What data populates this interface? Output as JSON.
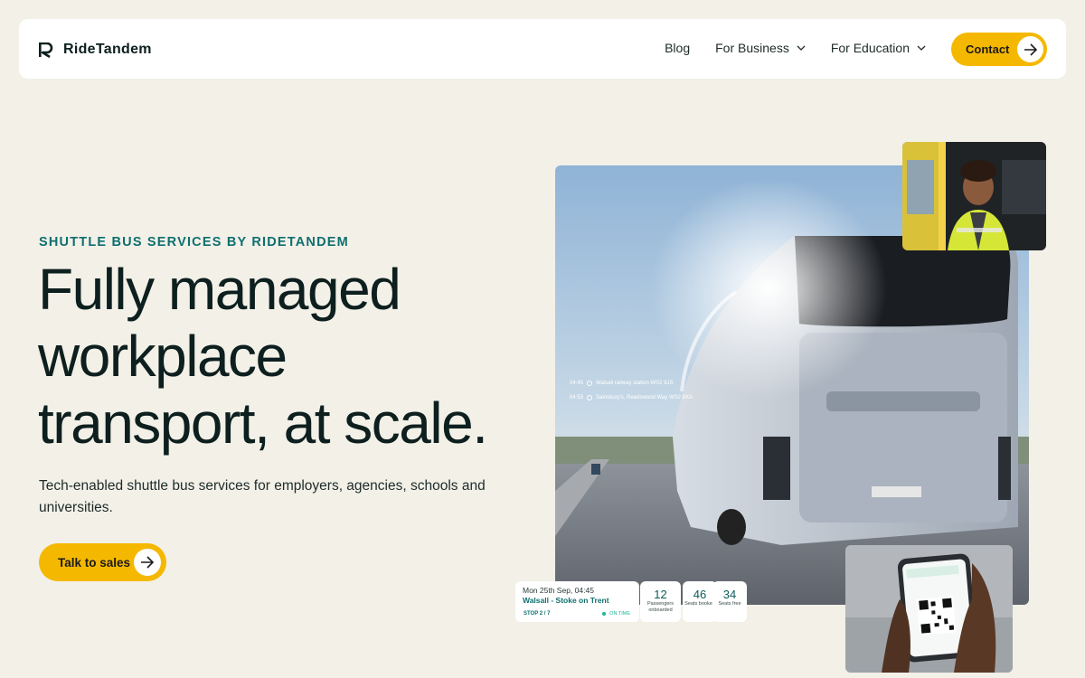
{
  "nav": {
    "brand": "RideTandem",
    "links": [
      {
        "label": "Blog",
        "has_dropdown": false
      },
      {
        "label": "For Business",
        "has_dropdown": true
      },
      {
        "label": "For Education",
        "has_dropdown": true
      }
    ],
    "contact_label": "Contact"
  },
  "hero": {
    "eyebrow": "SHUTTLE BUS SERVICES BY RIDETANDEM",
    "headline_lines": [
      "Fully managed",
      "workplace",
      "transport, at scale."
    ],
    "subhead": "Tech-enabled shuttle bus services for employers, agencies, schools and universities.",
    "cta_label": "Talk to sales"
  },
  "route_overlay": [
    {
      "time": "04:45",
      "stop": "Walsall railway station WS2 9JS"
    },
    {
      "time": "04:53",
      "stop": "Sainsbury's, Reedswood Way WS2 8XA"
    }
  ],
  "trip_card": {
    "date": "Mon 25th Sep, 04:45",
    "route": "Walsall - Stoke on Trent",
    "stop": "STOP 2 / 7",
    "status": "ON TIME"
  },
  "stats": [
    {
      "value": "12",
      "label": "Passengers onboarded"
    },
    {
      "value": "46",
      "label": "Seats booked"
    },
    {
      "value": "34",
      "label": "Seats free"
    }
  ],
  "colors": {
    "background": "#f2f0e7",
    "accent": "#f5b800",
    "teal": "#0f6f6f",
    "text": "#0d1f1e"
  }
}
